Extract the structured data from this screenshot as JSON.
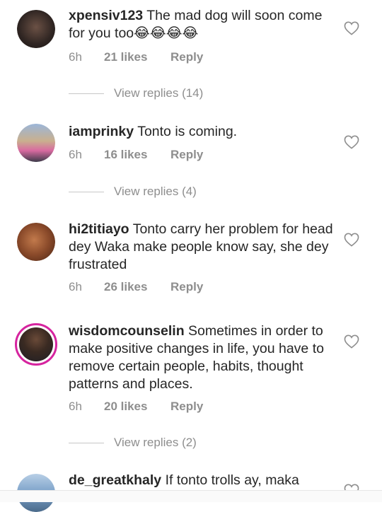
{
  "comments": [
    {
      "username": "xpensiv123",
      "text": "The mad dog will soon come for you too😂😂😂😂",
      "time": "6h",
      "likes": "21 likes",
      "reply": "Reply",
      "view_replies": "View replies (14)",
      "avatar_color": "#3a2f2c"
    },
    {
      "username": "iamprinky",
      "text": "Tonto is coming.",
      "time": "6h",
      "likes": "16 likes",
      "reply": "Reply",
      "view_replies": "View replies (4)",
      "avatar_color": "#5a7fb8"
    },
    {
      "username": "hi2titiayo",
      "text": "Tonto carry her problem for head dey Waka make people know say, she dey frustrated",
      "time": "6h",
      "likes": "26 likes",
      "reply": "Reply",
      "avatar_color": "#8a4a2a"
    },
    {
      "username": "wisdomcounselin",
      "text": "Sometimes in order to make positive changes in life, you have to remove certain people, habits, thought patterns and places.",
      "time": "6h",
      "likes": "20 likes",
      "reply": "Reply",
      "view_replies": "View replies (2)",
      "avatar_color": "#2b2b2b"
    },
    {
      "username": "de_greatkhaly",
      "text": "If tonto trolls ay,  maka",
      "avatar_color": "#7aa0c8"
    }
  ],
  "icons": {
    "heart": "heart-outline-icon"
  }
}
